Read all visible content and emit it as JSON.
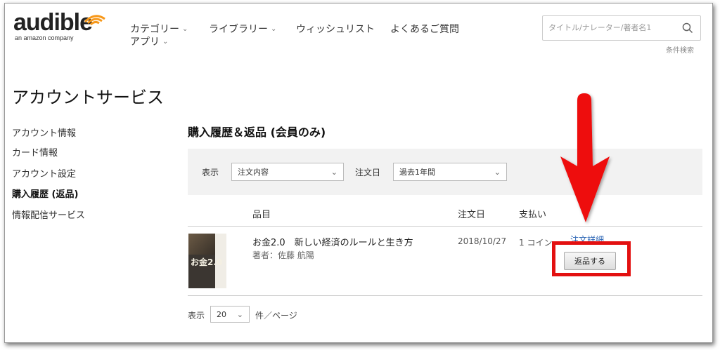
{
  "header": {
    "logo_word": "audible",
    "logo_sub": "an amazon company",
    "nav": [
      {
        "label": "カテゴリー",
        "has_dropdown": true
      },
      {
        "label": "ライブラリー",
        "has_dropdown": true
      },
      {
        "label": "ウィッシュリスト",
        "has_dropdown": false
      },
      {
        "label": "よくあるご質問",
        "has_dropdown": false
      },
      {
        "label": "アプリ",
        "has_dropdown": true
      }
    ],
    "search_placeholder": "タイトル/ナレーター/著者名1",
    "advanced_search": "条件検索"
  },
  "page_title": "アカウントサービス",
  "sidebar": {
    "items": [
      {
        "label": "アカウント情報",
        "active": false
      },
      {
        "label": "カード情報",
        "active": false
      },
      {
        "label": "アカウント設定",
        "active": false
      },
      {
        "label": "購入履歴 (返品)",
        "active": true
      },
      {
        "label": "情報配信サービス",
        "active": false
      }
    ]
  },
  "section_title": "購入履歴＆返品 (会員のみ)",
  "filters": {
    "display_label": "表示",
    "display_value": "注文内容",
    "order_date_label": "注文日",
    "order_date_value": "過去1年間"
  },
  "table": {
    "headers": {
      "item": "品目",
      "order_date": "注文日",
      "payment": "支払い"
    },
    "rows": [
      {
        "title": "お金2.0　新しい経済のルールと生き方",
        "author": "著者：佐藤 航陽",
        "cover_text": "お金2.0",
        "order_date": "2018/10/27",
        "payment": "1 コイン",
        "detail_link": "注文詳細",
        "return_button": "返品する"
      }
    ]
  },
  "pager": {
    "label_before": "表示",
    "per_page": "20",
    "label_after": "件／ページ"
  },
  "colors": {
    "accent_orange": "#f7991c",
    "highlight_red": "#e31010",
    "link_blue": "#2a64b4"
  }
}
